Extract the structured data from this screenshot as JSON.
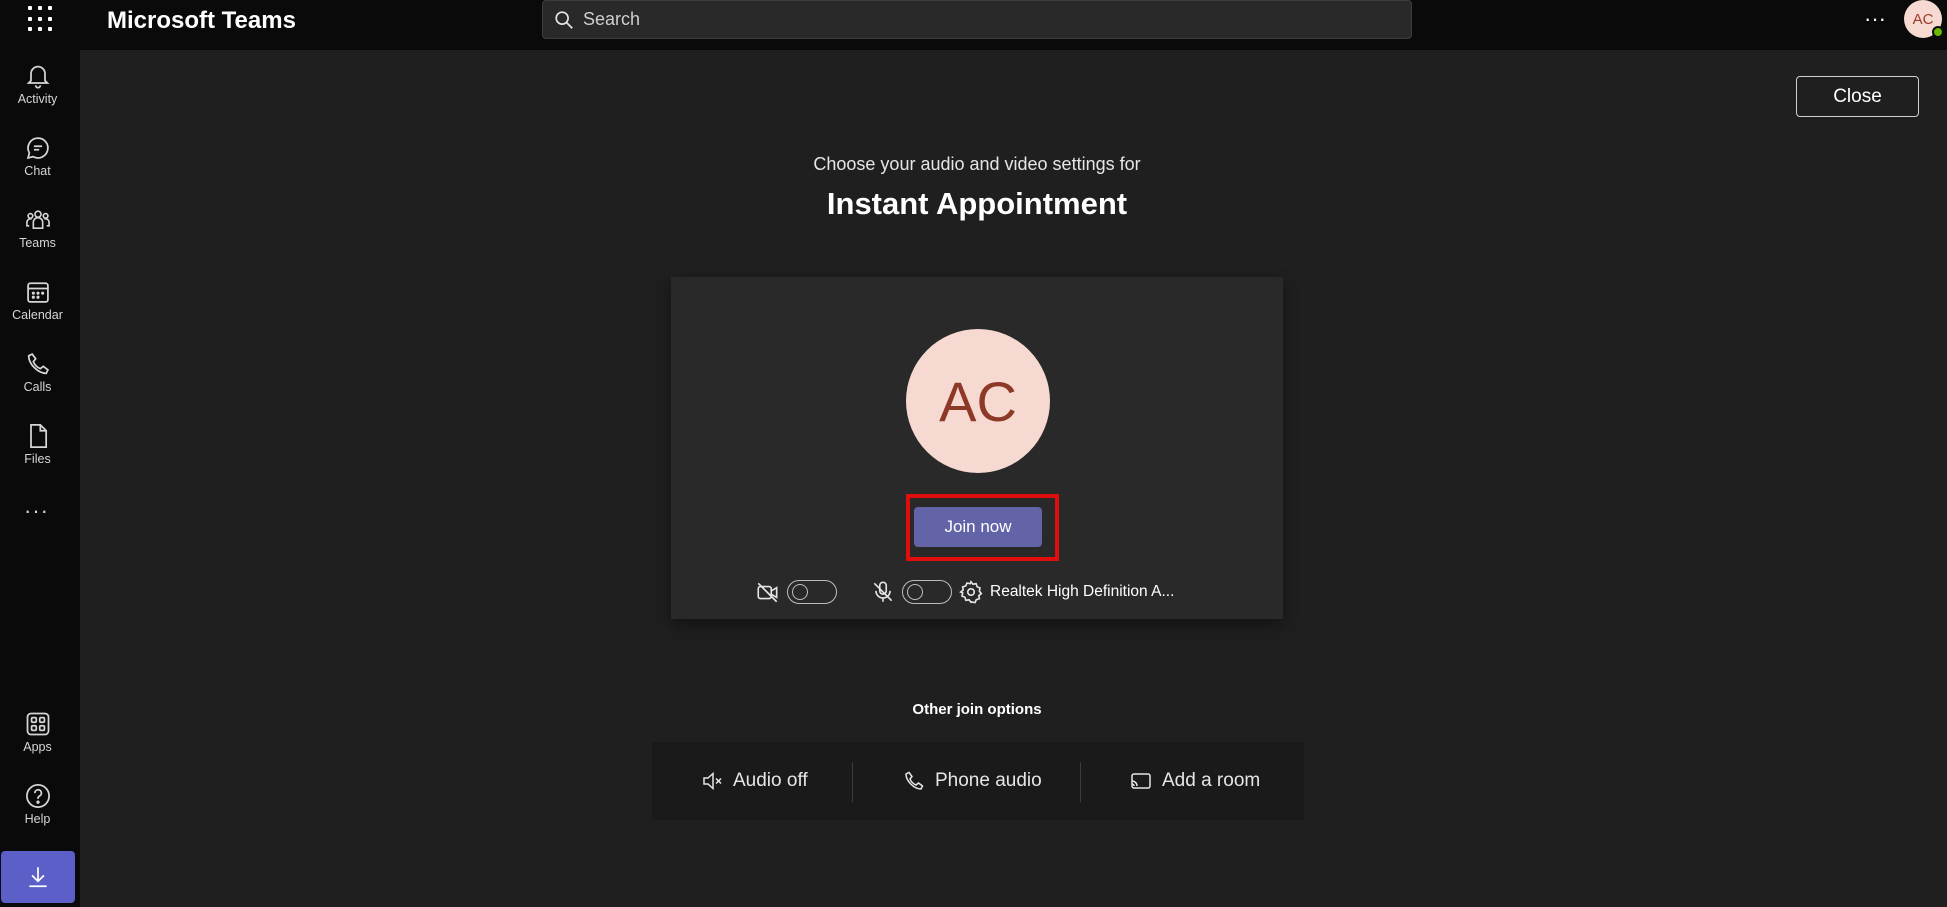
{
  "topbar": {
    "app_title": "Microsoft Teams",
    "search_placeholder": "Search",
    "more_label": "···",
    "user_initials": "AC"
  },
  "rail": {
    "items": [
      {
        "label": "Activity",
        "icon": "bell-icon"
      },
      {
        "label": "Chat",
        "icon": "chat-icon"
      },
      {
        "label": "Teams",
        "icon": "teams-icon"
      },
      {
        "label": "Calendar",
        "icon": "calendar-icon"
      },
      {
        "label": "Calls",
        "icon": "phone-icon"
      },
      {
        "label": "Files",
        "icon": "file-icon"
      }
    ],
    "more_label": "···",
    "bottom_items": [
      {
        "label": "Apps",
        "icon": "apps-icon"
      },
      {
        "label": "Help",
        "icon": "help-icon"
      }
    ]
  },
  "prejoin": {
    "close_label": "Close",
    "subtitle": "Choose your audio and video settings for",
    "meeting_title": "Instant Appointment",
    "avatar_initials": "AC",
    "join_label": "Join now",
    "audio_device": "Realtek High Definition A...",
    "camera_on": false,
    "mic_on": false
  },
  "other_options": {
    "heading": "Other join options",
    "items": [
      {
        "label": "Audio off",
        "icon": "speaker-off-icon"
      },
      {
        "label": "Phone audio",
        "icon": "phone-icon"
      },
      {
        "label": "Add a room",
        "icon": "cast-icon"
      }
    ]
  },
  "colors": {
    "accent": "#6264a7",
    "highlight": "#e00d0d",
    "avatar_bg": "#f6d9d1",
    "avatar_text": "#8e3827"
  }
}
